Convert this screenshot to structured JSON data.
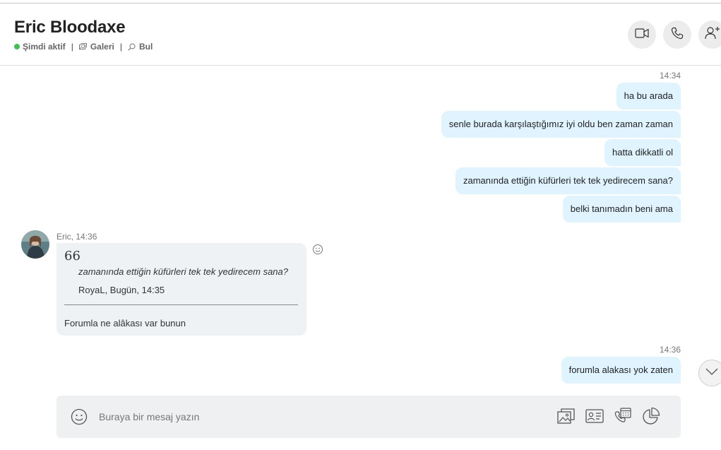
{
  "header": {
    "contact_name": "Eric Bloodaxe",
    "status": "Şimdi aktif",
    "gallery": "Galeri",
    "find": "Bul",
    "separator": "|"
  },
  "colors": {
    "status_active": "#3fc154",
    "outgoing_bubble": "#dff4ff",
    "incoming_bubble": "#eef2f5",
    "composer_bg": "#eef0f2"
  },
  "messages": {
    "group1": {
      "time": "14:34",
      "items": [
        "ha bu arada",
        "senle burada karşılaştığımız iyi oldu ben zaman zaman",
        "hatta dikkatli ol",
        "zamanında ettiğin küfürleri tek tek yedirecem sana?",
        "belki tanımadın beni ama"
      ]
    },
    "incoming": {
      "meta": "Eric, 14:36",
      "quote_mark": "66",
      "quote_text": "zamanında ettiğin küfürleri tek tek yedirecem sana?",
      "quote_author": "RoyaL, Bugün, 14:35",
      "text": "Forumla ne alâkası var bunun"
    },
    "group2": {
      "time": "14:36",
      "items": [
        "forumla alakası yok zaten"
      ]
    }
  },
  "composer": {
    "placeholder": "Buraya bir mesaj yazın"
  },
  "icons": {
    "video_call": "video-camera-icon",
    "audio_call": "phone-icon",
    "add_people": "add-person-icon",
    "emoji": "smiley-icon",
    "media": "image-icon",
    "contact_card": "contact-card-icon",
    "schedule": "calendar-icon",
    "poll": "pie-chart-icon",
    "scroll_down": "chevron-down-icon"
  }
}
